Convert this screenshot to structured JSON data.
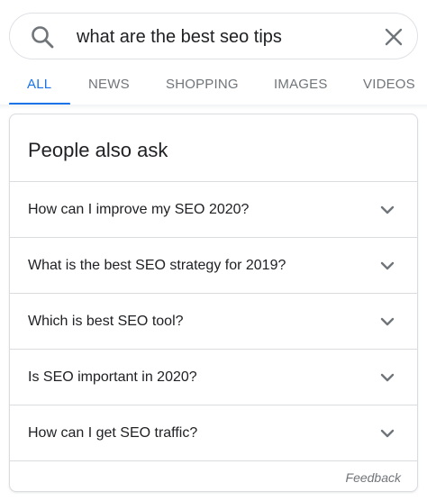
{
  "search": {
    "query": "what are the best seo tips",
    "search_icon": "search-icon",
    "clear_icon": "close-icon"
  },
  "tabs": [
    {
      "label": "ALL",
      "active": true
    },
    {
      "label": "NEWS",
      "active": false
    },
    {
      "label": "SHOPPING",
      "active": false
    },
    {
      "label": "IMAGES",
      "active": false
    },
    {
      "label": "VIDEOS",
      "active": false
    }
  ],
  "people_also_ask": {
    "title": "People also ask",
    "questions": [
      "How can I improve my SEO 2020?",
      "What is the best SEO strategy for 2019?",
      "Which is best SEO tool?",
      "Is SEO important in 2020?",
      "How can I get SEO traffic?"
    ],
    "expand_icon": "chevron-down-icon",
    "feedback_label": "Feedback"
  },
  "colors": {
    "accent": "#1a73e8",
    "text_primary": "#202124",
    "text_secondary": "#70757a",
    "border": "#dadce0"
  }
}
